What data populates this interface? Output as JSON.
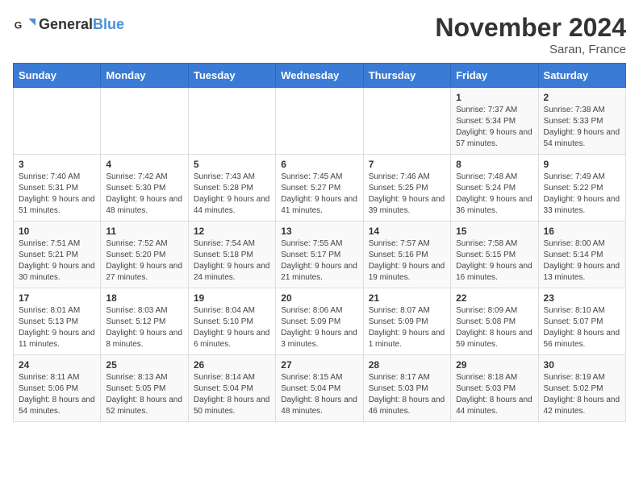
{
  "logo": {
    "general": "General",
    "blue": "Blue"
  },
  "title": "November 2024",
  "location": "Saran, France",
  "days_of_week": [
    "Sunday",
    "Monday",
    "Tuesday",
    "Wednesday",
    "Thursday",
    "Friday",
    "Saturday"
  ],
  "weeks": [
    [
      {
        "day": "",
        "info": ""
      },
      {
        "day": "",
        "info": ""
      },
      {
        "day": "",
        "info": ""
      },
      {
        "day": "",
        "info": ""
      },
      {
        "day": "",
        "info": ""
      },
      {
        "day": "1",
        "info": "Sunrise: 7:37 AM\nSunset: 5:34 PM\nDaylight: 9 hours and 57 minutes."
      },
      {
        "day": "2",
        "info": "Sunrise: 7:38 AM\nSunset: 5:33 PM\nDaylight: 9 hours and 54 minutes."
      }
    ],
    [
      {
        "day": "3",
        "info": "Sunrise: 7:40 AM\nSunset: 5:31 PM\nDaylight: 9 hours and 51 minutes."
      },
      {
        "day": "4",
        "info": "Sunrise: 7:42 AM\nSunset: 5:30 PM\nDaylight: 9 hours and 48 minutes."
      },
      {
        "day": "5",
        "info": "Sunrise: 7:43 AM\nSunset: 5:28 PM\nDaylight: 9 hours and 44 minutes."
      },
      {
        "day": "6",
        "info": "Sunrise: 7:45 AM\nSunset: 5:27 PM\nDaylight: 9 hours and 41 minutes."
      },
      {
        "day": "7",
        "info": "Sunrise: 7:46 AM\nSunset: 5:25 PM\nDaylight: 9 hours and 39 minutes."
      },
      {
        "day": "8",
        "info": "Sunrise: 7:48 AM\nSunset: 5:24 PM\nDaylight: 9 hours and 36 minutes."
      },
      {
        "day": "9",
        "info": "Sunrise: 7:49 AM\nSunset: 5:22 PM\nDaylight: 9 hours and 33 minutes."
      }
    ],
    [
      {
        "day": "10",
        "info": "Sunrise: 7:51 AM\nSunset: 5:21 PM\nDaylight: 9 hours and 30 minutes."
      },
      {
        "day": "11",
        "info": "Sunrise: 7:52 AM\nSunset: 5:20 PM\nDaylight: 9 hours and 27 minutes."
      },
      {
        "day": "12",
        "info": "Sunrise: 7:54 AM\nSunset: 5:18 PM\nDaylight: 9 hours and 24 minutes."
      },
      {
        "day": "13",
        "info": "Sunrise: 7:55 AM\nSunset: 5:17 PM\nDaylight: 9 hours and 21 minutes."
      },
      {
        "day": "14",
        "info": "Sunrise: 7:57 AM\nSunset: 5:16 PM\nDaylight: 9 hours and 19 minutes."
      },
      {
        "day": "15",
        "info": "Sunrise: 7:58 AM\nSunset: 5:15 PM\nDaylight: 9 hours and 16 minutes."
      },
      {
        "day": "16",
        "info": "Sunrise: 8:00 AM\nSunset: 5:14 PM\nDaylight: 9 hours and 13 minutes."
      }
    ],
    [
      {
        "day": "17",
        "info": "Sunrise: 8:01 AM\nSunset: 5:13 PM\nDaylight: 9 hours and 11 minutes."
      },
      {
        "day": "18",
        "info": "Sunrise: 8:03 AM\nSunset: 5:12 PM\nDaylight: 9 hours and 8 minutes."
      },
      {
        "day": "19",
        "info": "Sunrise: 8:04 AM\nSunset: 5:10 PM\nDaylight: 9 hours and 6 minutes."
      },
      {
        "day": "20",
        "info": "Sunrise: 8:06 AM\nSunset: 5:09 PM\nDaylight: 9 hours and 3 minutes."
      },
      {
        "day": "21",
        "info": "Sunrise: 8:07 AM\nSunset: 5:09 PM\nDaylight: 9 hours and 1 minute."
      },
      {
        "day": "22",
        "info": "Sunrise: 8:09 AM\nSunset: 5:08 PM\nDaylight: 8 hours and 59 minutes."
      },
      {
        "day": "23",
        "info": "Sunrise: 8:10 AM\nSunset: 5:07 PM\nDaylight: 8 hours and 56 minutes."
      }
    ],
    [
      {
        "day": "24",
        "info": "Sunrise: 8:11 AM\nSunset: 5:06 PM\nDaylight: 8 hours and 54 minutes."
      },
      {
        "day": "25",
        "info": "Sunrise: 8:13 AM\nSunset: 5:05 PM\nDaylight: 8 hours and 52 minutes."
      },
      {
        "day": "26",
        "info": "Sunrise: 8:14 AM\nSunset: 5:04 PM\nDaylight: 8 hours and 50 minutes."
      },
      {
        "day": "27",
        "info": "Sunrise: 8:15 AM\nSunset: 5:04 PM\nDaylight: 8 hours and 48 minutes."
      },
      {
        "day": "28",
        "info": "Sunrise: 8:17 AM\nSunset: 5:03 PM\nDaylight: 8 hours and 46 minutes."
      },
      {
        "day": "29",
        "info": "Sunrise: 8:18 AM\nSunset: 5:03 PM\nDaylight: 8 hours and 44 minutes."
      },
      {
        "day": "30",
        "info": "Sunrise: 8:19 AM\nSunset: 5:02 PM\nDaylight: 8 hours and 42 minutes."
      }
    ]
  ]
}
